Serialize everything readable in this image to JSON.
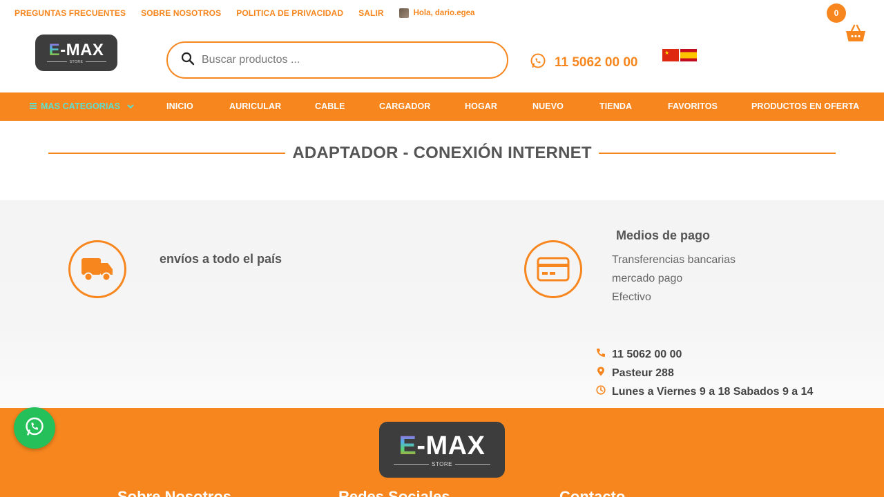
{
  "topbar": {
    "links": [
      "PREGUNTAS FRECUENTES",
      "SOBRE NOSOTROS",
      "POLITICA DE PRIVACIDAD",
      "SALIR"
    ],
    "greeting": "Hola, dario.egea"
  },
  "logo": {
    "main": "-MAX",
    "letter": "E",
    "sub": "STORE"
  },
  "search": {
    "placeholder": "Buscar productos ..."
  },
  "phone": "11 5062 00 00",
  "cart": {
    "count": "0"
  },
  "nav": {
    "categories": "MAS CATEGORIAS",
    "items": [
      "INICIO",
      "AURICULAR",
      "CABLE",
      "CARGADOR",
      "HOGAR",
      "NUEVO",
      "TIENDA",
      "FAVORITOS",
      "PRODUCTOS EN OFERTA"
    ]
  },
  "page_title": "ADAPTADOR - CONEXIÓN INTERNET",
  "info": {
    "shipping": "envíos a todo el país",
    "payment_title": "Medios de pago",
    "payment_methods": [
      "Transferencias bancarias",
      "mercado pago",
      "Efectivo"
    ],
    "contact": {
      "phone": "11 5062 00 00",
      "address": "Pasteur 288",
      "hours": "Lunes a Viernes 9 a 18 Sabados 9 a 14"
    }
  },
  "footer": {
    "columns": [
      "Sobre Nosotros",
      "Redes Sociales",
      "Contacto"
    ]
  },
  "colors": {
    "accent": "#f7861e",
    "dark": "#3d3d3d",
    "whatsapp": "#25c05a"
  },
  "icons": [
    "search-icon",
    "whatsapp-icon",
    "basket-icon",
    "truck-icon",
    "credit-card-icon",
    "phone-icon",
    "location-pin-icon",
    "clock-icon",
    "menu-icon",
    "chevron-down-icon"
  ]
}
